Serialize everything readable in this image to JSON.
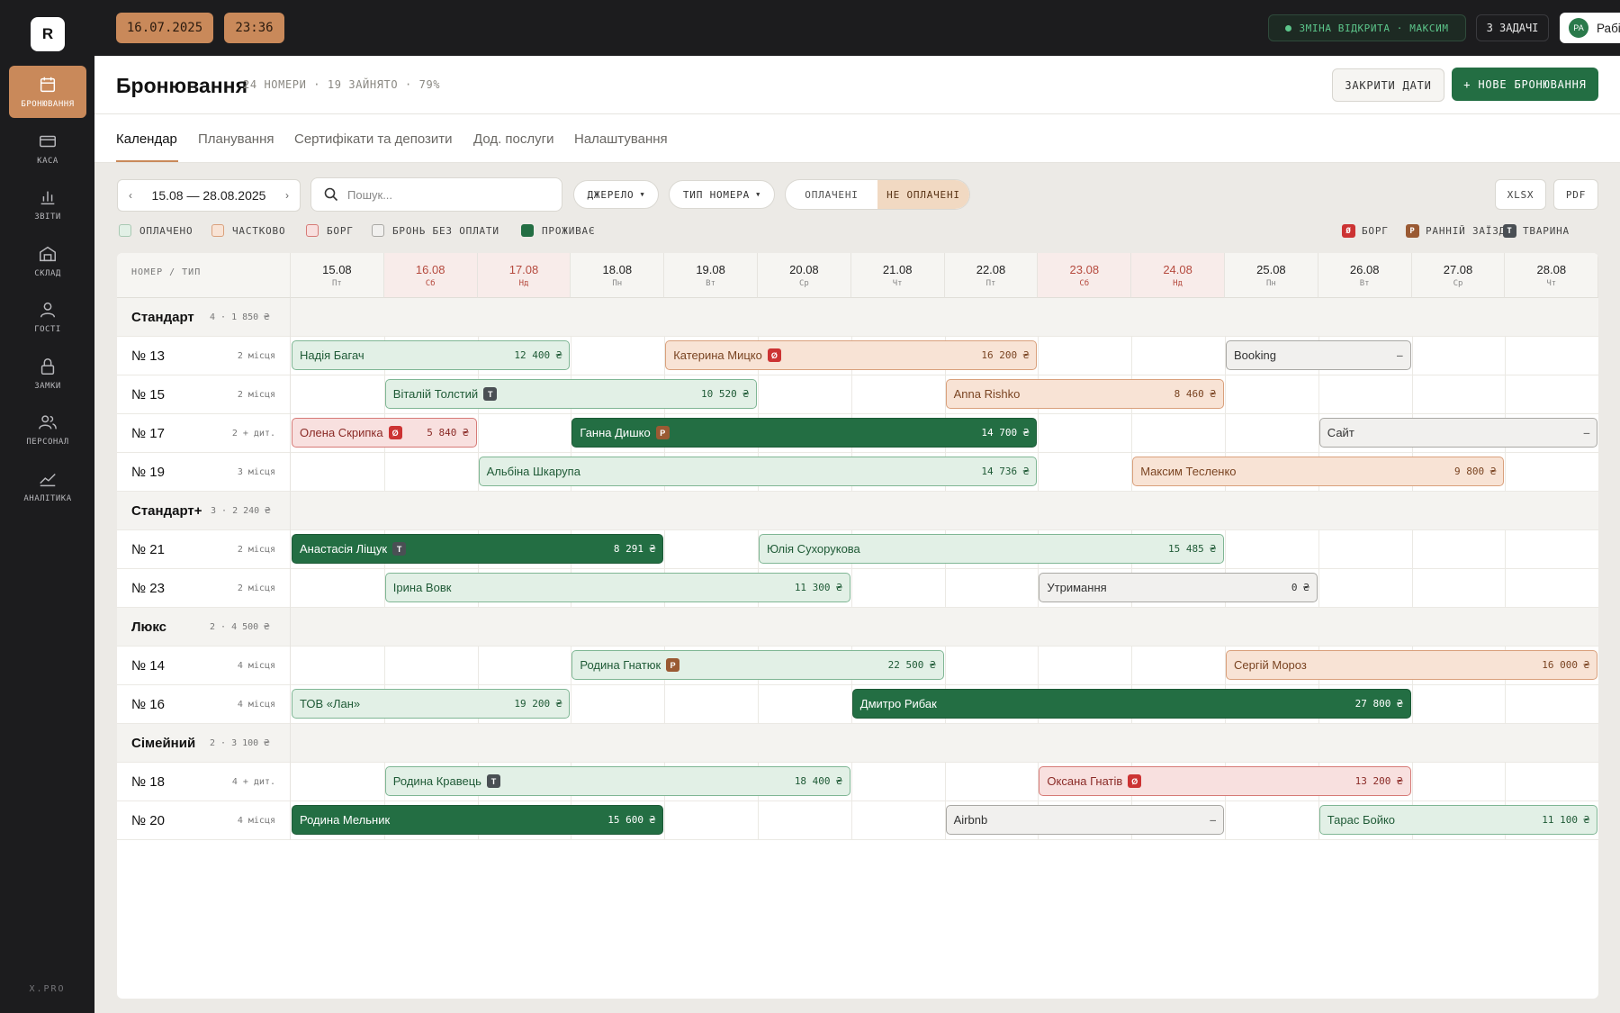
{
  "app": {
    "logo": "R",
    "footer": "X.PRO"
  },
  "sidebar": {
    "items": [
      {
        "label": "БРОНЮВАННЯ",
        "icon": "calendar-icon",
        "active": true
      },
      {
        "label": "КАСА",
        "icon": "cash-icon"
      },
      {
        "label": "ЗВІТИ",
        "icon": "bar-chart-icon"
      },
      {
        "label": "СКЛАД",
        "icon": "warehouse-icon"
      },
      {
        "label": "ГОСТІ",
        "icon": "user-icon"
      },
      {
        "label": "ЗАМКИ",
        "icon": "lock-icon"
      },
      {
        "label": "ПЕРСОНАЛ",
        "icon": "users-icon"
      },
      {
        "label": "АНАЛІТИКА",
        "icon": "trend-icon"
      }
    ]
  },
  "topbar": {
    "date": "16.07.2025",
    "time": "23:36",
    "shift": "ЗМІНА ВІДКРИТА · МАКСИМ",
    "tasks": "3 ЗАДАЧІ",
    "user_initials": "РА",
    "user_name": "Рабінович А. В."
  },
  "header": {
    "title": "Бронювання",
    "stats": "24 НОМЕРИ · 19 ЗАЙНЯТО · 79%",
    "close_dates": "ЗАКРИТИ ДАТИ",
    "new_booking": "+ НОВЕ БРОНЮВАННЯ"
  },
  "tabs": [
    "Календар",
    "Планування",
    "Сертифікати та депозити",
    "Дод. послуги",
    "Налаштування"
  ],
  "filters": {
    "range": "15.08 — 28.08.2025",
    "search_placeholder": "Пошук...",
    "source": "ДЖЕРЕЛО",
    "room_type": "ТИП НОМЕРА",
    "paid": "ОПЛАЧЕНІ",
    "unpaid": "НЕ ОПЛАЧЕНІ",
    "xlsx": "XLSX",
    "pdf": "PDF"
  },
  "legend": {
    "paid": "ОПЛАЧЕНО",
    "partial": "ЧАСТКОВО",
    "debt": "БОРГ",
    "unpaid": "БРОНЬ БЕЗ ОПЛАТИ",
    "living": "ПРОЖИВАЄ",
    "flag_debt": "БОРГ",
    "flag_early": "РАННІЙ ЗАЇЗД",
    "flag_animal": "ТВАРИНА"
  },
  "colors": {
    "accent": "#c9895a",
    "green": "#236e43",
    "paid_bg": "#e2f0e6",
    "partial_bg": "#f8e3d5",
    "debt_bg": "#f8e0df",
    "unpaid_bg": "#f1f0ee"
  },
  "calendar": {
    "corner": "НОМЕР / ТИП",
    "days": [
      {
        "date": "15.08",
        "wd": "Пт"
      },
      {
        "date": "16.08",
        "wd": "Сб",
        "weekend": true
      },
      {
        "date": "17.08",
        "wd": "Нд",
        "weekend": true
      },
      {
        "date": "18.08",
        "wd": "Пн"
      },
      {
        "date": "19.08",
        "wd": "Вт"
      },
      {
        "date": "20.08",
        "wd": "Ср"
      },
      {
        "date": "21.08",
        "wd": "Чт"
      },
      {
        "date": "22.08",
        "wd": "Пт"
      },
      {
        "date": "23.08",
        "wd": "Сб",
        "weekend": true
      },
      {
        "date": "24.08",
        "wd": "Нд",
        "weekend": true
      },
      {
        "date": "25.08",
        "wd": "Пн"
      },
      {
        "date": "26.08",
        "wd": "Вт"
      },
      {
        "date": "27.08",
        "wd": "Ср"
      },
      {
        "date": "28.08",
        "wd": "Чт"
      }
    ],
    "rows": [
      {
        "type": "group",
        "name": "Стандарт",
        "meta": "4 · 1 850 ₴"
      },
      {
        "type": "room",
        "name": "№ 13",
        "cap": "2 місця",
        "bookings": [
          {
            "guest": "Надія Багач",
            "price": "12 400 ₴",
            "status": "paid",
            "start": 0,
            "span": 3
          },
          {
            "guest": "Катерина Мицко",
            "price": "16 200 ₴",
            "status": "part",
            "start": 4,
            "span": 4,
            "flag": "debt"
          },
          {
            "guest": "Booking",
            "price": "–",
            "status": "unpaid",
            "start": 10,
            "span": 2
          }
        ]
      },
      {
        "type": "room",
        "name": "№ 15",
        "cap": "2 місця",
        "bookings": [
          {
            "guest": "Віталій Толстий",
            "price": "10 520 ₴",
            "status": "paid",
            "start": 1,
            "span": 4,
            "flag": "animal"
          },
          {
            "guest": "Anna Rishko",
            "price": "8 460 ₴",
            "status": "part",
            "start": 7,
            "span": 3
          }
        ]
      },
      {
        "type": "room",
        "name": "№ 17",
        "cap": "2 + дит.",
        "bookings": [
          {
            "guest": "Олена Скрипка",
            "price": "5 840 ₴",
            "status": "debt",
            "start": 0,
            "span": 2,
            "flag": "debt"
          },
          {
            "guest": "Ганна Дишко",
            "price": "14 700 ₴",
            "status": "live",
            "start": 3,
            "span": 5,
            "flag": "early"
          },
          {
            "guest": "Сайт",
            "price": "–",
            "status": "unpaid",
            "start": 11,
            "span": 3
          }
        ]
      },
      {
        "type": "room",
        "name": "№ 19",
        "cap": "3 місця",
        "bookings": [
          {
            "guest": "Альбіна Шкарупа",
            "price": "14 736 ₴",
            "status": "paid",
            "start": 2,
            "span": 6
          },
          {
            "guest": "Максим Тесленко",
            "price": "9 800 ₴",
            "status": "part",
            "start": 9,
            "span": 4
          }
        ]
      },
      {
        "type": "group",
        "name": "Стандарт+",
        "meta": "3 · 2 240 ₴"
      },
      {
        "type": "room",
        "name": "№ 21",
        "cap": "2 місця",
        "bookings": [
          {
            "guest": "Анастасія Ліщук",
            "price": "8 291 ₴",
            "status": "live",
            "start": 0,
            "span": 4,
            "flag": "animal"
          },
          {
            "guest": "Юлія Сухорукова",
            "price": "15 485 ₴",
            "status": "paid",
            "start": 5,
            "span": 5
          }
        ]
      },
      {
        "type": "room",
        "name": "№ 23",
        "cap": "2 місця",
        "bookings": [
          {
            "guest": "Ірина Вовк",
            "price": "11 300 ₴",
            "status": "paid",
            "start": 1,
            "span": 5
          },
          {
            "guest": "Утримання",
            "price": "0 ₴",
            "status": "unpaid",
            "start": 8,
            "span": 3
          }
        ]
      },
      {
        "type": "group",
        "name": "Люкс",
        "meta": "2 · 4 500 ₴"
      },
      {
        "type": "room",
        "name": "№ 14",
        "cap": "4 місця",
        "bookings": [
          {
            "guest": "Родина Гнатюк",
            "price": "22 500 ₴",
            "status": "paid",
            "start": 3,
            "span": 4,
            "flag": "early"
          },
          {
            "guest": "Сергій Мороз",
            "price": "16 000 ₴",
            "status": "part",
            "start": 10,
            "span": 4
          }
        ]
      },
      {
        "type": "room",
        "name": "№ 16",
        "cap": "4 місця",
        "bookings": [
          {
            "guest": "ТОВ «Лан»",
            "price": "19 200 ₴",
            "status": "paid",
            "start": 0,
            "span": 3
          },
          {
            "guest": "Дмитро Рибак",
            "price": "27 800 ₴",
            "status": "live",
            "start": 6,
            "span": 6
          }
        ]
      },
      {
        "type": "group",
        "name": "Сімейний",
        "meta": "2 · 3 100 ₴"
      },
      {
        "type": "room",
        "name": "№ 18",
        "cap": "4 + дит.",
        "bookings": [
          {
            "guest": "Родина Кравець",
            "price": "18 400 ₴",
            "status": "paid",
            "start": 1,
            "span": 5,
            "flag": "animal"
          },
          {
            "guest": "Оксана Гнатів",
            "price": "13 200 ₴",
            "status": "debt",
            "start": 8,
            "span": 4,
            "flag": "debt"
          }
        ]
      },
      {
        "type": "room",
        "name": "№ 20",
        "cap": "4 місця",
        "bookings": [
          {
            "guest": "Родина Мельник",
            "price": "15 600 ₴",
            "status": "live",
            "start": 0,
            "span": 4
          },
          {
            "guest": "Airbnb",
            "price": "–",
            "status": "unpaid",
            "start": 7,
            "span": 3
          },
          {
            "guest": "Тарас Бойко",
            "price": "11 100 ₴",
            "status": "paid",
            "start": 11,
            "span": 3
          }
        ]
      }
    ]
  },
  "flag_letters": {
    "debt": "Ø",
    "early": "Р",
    "animal": "Т"
  }
}
